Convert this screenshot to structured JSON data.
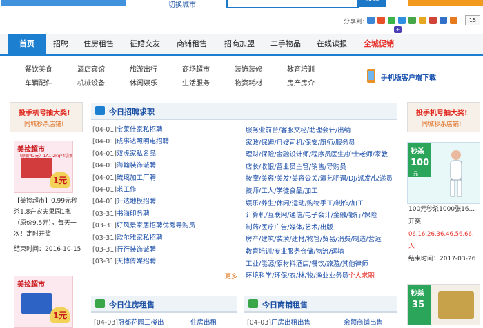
{
  "header": {
    "city_switch": "切换城市",
    "search_button": "搜索",
    "share_label": "分享到:",
    "share_count": "15"
  },
  "nav": {
    "items": [
      "首页",
      "招聘",
      "住房租售",
      "征婚交友",
      "商铺租售",
      "招商加盟",
      "二手物品",
      "在线读报",
      "全城促销"
    ]
  },
  "categories": {
    "row1": [
      "餐饮美食",
      "酒店宾馆",
      "旅游出行",
      "商场超市",
      "装饰装修",
      "教育培训"
    ],
    "row2": [
      "车辆配件",
      "机械设备",
      "休闲娱乐",
      "生活服务",
      "物资耗材",
      "房产房介"
    ],
    "app_banner": "手机版客户端下载"
  },
  "left_side": {
    "head_line1": "投手机号抽大奖!",
    "head_line2": "同城秒杀店铺!",
    "promo1": {
      "title": "美捡超市",
      "sub": "（原价42元）1A1.2kg*4袋抽奖",
      "badge": "1元"
    },
    "promo1_text": [
      "【美捡超市】0.99元秒",
      "杀1.8升农夫果园1瓶",
      "（原价9.5元），每天一",
      "次！定时开奖"
    ],
    "promo1_end_label": "结束时间：",
    "promo1_end_date": "2016-10-15",
    "promo2": {
      "title": "美捡超市",
      "badge": "1元"
    }
  },
  "jobs_panel": {
    "title": "今日招聘求职",
    "rows": [
      {
        "date": "[04-01]",
        "title": "宝莱佳家私招聘"
      },
      {
        "date": "[04-01]",
        "title": "成事达照明电招聘"
      },
      {
        "date": "[04-01]",
        "title": "双虎家私名品"
      },
      {
        "date": "[04-01]",
        "title": "海翰装饰诚聘"
      },
      {
        "date": "[04-01]",
        "title": "琉璃加工厂聘"
      },
      {
        "date": "[04-01]",
        "title": "求工作"
      },
      {
        "date": "[04-01]",
        "title": "升达地板招聘"
      },
      {
        "date": "[03-31]",
        "title": "书海印务聘"
      },
      {
        "date": "[03-31]",
        "title": "好风景家居招聘优秀导购员"
      },
      {
        "date": "[03-31]",
        "title": "欧尔雅家私招聘"
      },
      {
        "date": "[03-31]",
        "title": "行行装饰诚聘"
      },
      {
        "date": "[03-31]",
        "title": "天博传媒招聘"
      }
    ],
    "right_links": [
      "服务业前台/客服文秘/助理会计/出纳",
      "家政/保姆/月嫂司机/保安/厨师/服务员",
      "理财/保险/金融设计师/程序员医生/护士老师/家教",
      "店长/收银/营业员主管/销售/导购员",
      "按摩/美容/美发/美容公关/演艺吧调/DJ/派发/快递员",
      "技师/工人/学徒食品/加工",
      "娱乐/养生/休闲/运动/购物手工/制作/加工",
      "计算机/互联网/通信/电子会计/金融/银行/保险",
      "制药/医疗广告/媒体/艺术/出版",
      "房产/建筑/装潢/建材/物管/贸易/消费/制造/营运",
      "教育培训/专业服务仓储/物流/运输",
      "工业/能源/原材料酒店/餐饮/旅游/其他律师",
      "环境科学/环保/农/林/牧/渔业业务员"
    ],
    "personal_resume": "个人求职",
    "more": "更多"
  },
  "housing_panel": {
    "title": "今日住房租售",
    "row_date": "[04-03]",
    "row_title": "冠都花园三楼出",
    "extra": "住房出租"
  },
  "shop_panel": {
    "title": "今日商铺租售",
    "row_date": "[04-03]",
    "row_title": "厂房出租出售",
    "extra": "余额商铺出售"
  },
  "right_side": {
    "head_line1": "投手机号抽大奖!",
    "head_line2": "同城秒杀店铺!",
    "sale": {
      "s1": "秒杀",
      "s2": "100",
      "s3": "元"
    },
    "caption": "100元秒杀1000张16...",
    "draw_label": "开奖",
    "numbers": "06,16,26,36,46,56,66,",
    "person_label": "人",
    "end_label": "结束时间：",
    "end_date": "2017-03-26",
    "sale2": {
      "s1": "秒杀",
      "s2": "35"
    }
  },
  "colors": {
    "brand_blue": "#1d7fd0",
    "link_blue": "#1b4ea8",
    "hot_red": "#e7312a",
    "orange": "#f29a1e"
  }
}
